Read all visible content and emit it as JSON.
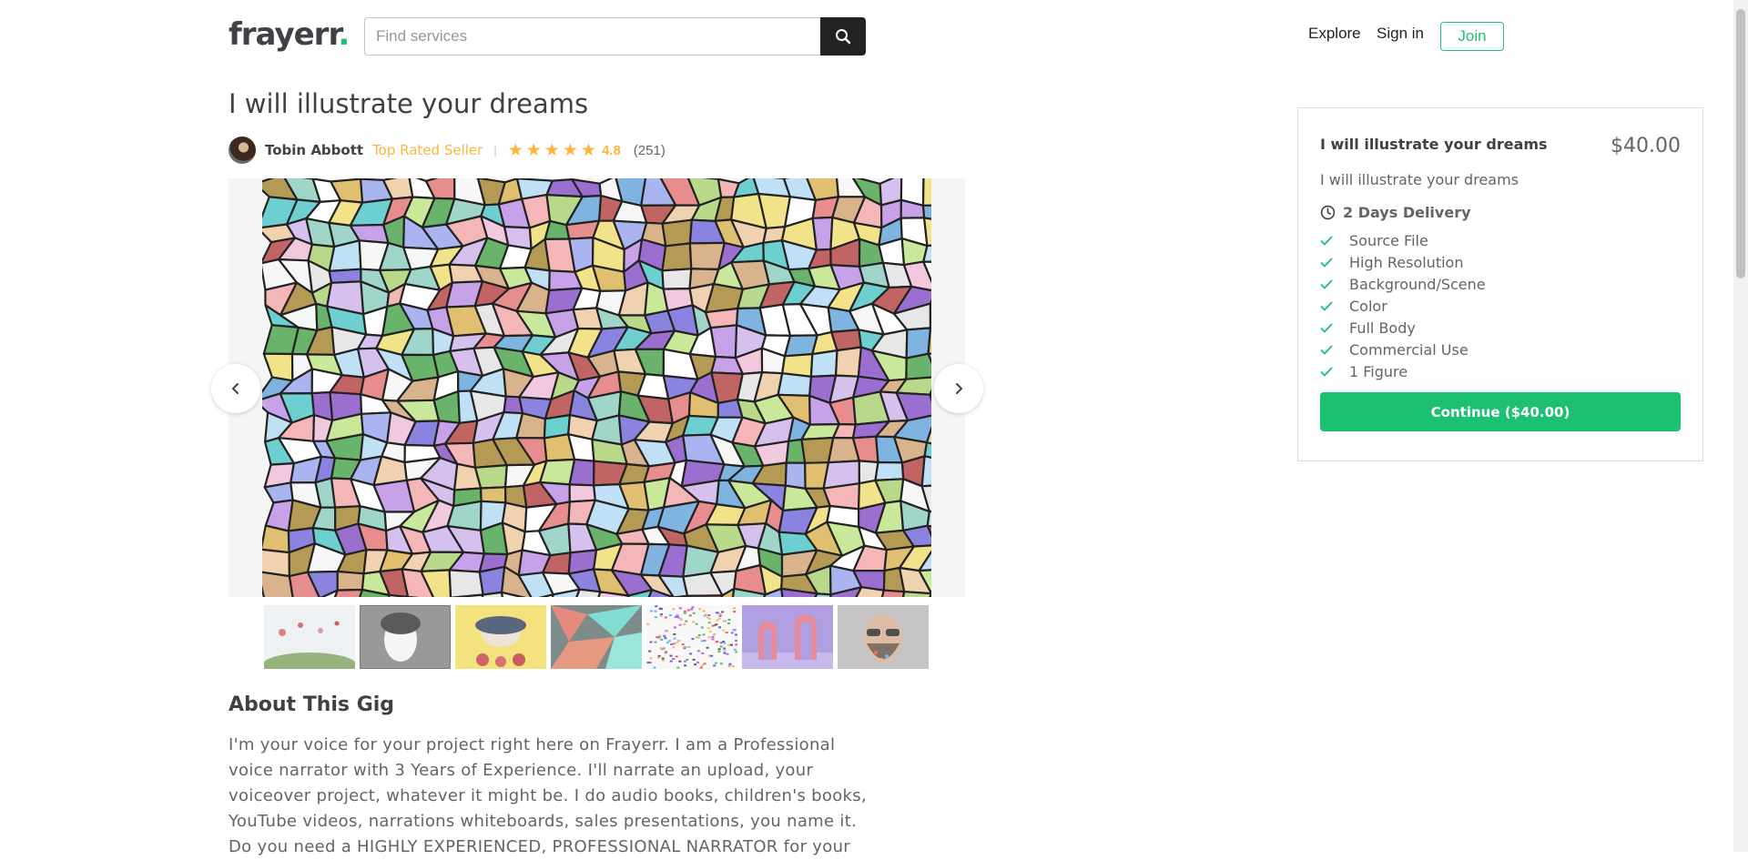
{
  "header": {
    "logo_text": "frayerr",
    "logo_dot": ".",
    "search_placeholder": "Find services",
    "nav_explore": "Explore",
    "nav_signin": "Sign in",
    "nav_join": "Join",
    "brand_color": "#1dbf73"
  },
  "gig": {
    "title": "I will illustrate your dreams",
    "seller_name": "Tobin Abbott",
    "seller_level": "Top Rated Seller",
    "rating": "4.8",
    "reviews": "(251)",
    "stars_filled": 5,
    "star_color": "#ffb33e"
  },
  "gallery": {
    "main_image": "stained-glass-mosaic",
    "thumbnails": [
      "watercolor-landscape",
      "pencil-portrait",
      "yellow-portrait",
      "geometric-shapes",
      "colorful-letters",
      "pink-arches",
      "bearded-man"
    ]
  },
  "about": {
    "heading": "About This Gig",
    "body": "I'm your voice for your project right here on Frayerr. I am a Professional voice narrator with 3 Years of Experience. I'll narrate an upload, your voiceover project, whatever it might be. I do audio books, children's books, YouTube videos, narrations whiteboards, sales presentations, you name it. Do you need a HIGHLY EXPERIENCED, PROFESSIONAL NARRATOR for your"
  },
  "package": {
    "title": "I will illustrate your dreams",
    "price": "$40.00",
    "description": "I will illustrate your dreams",
    "delivery": "2 Days Delivery",
    "features": [
      "Source File",
      "High Resolution",
      "Background/Scene",
      "Color",
      "Full Body",
      "Commercial Use",
      "1 Figure"
    ],
    "continue_label": "Continue ($40.00)"
  }
}
